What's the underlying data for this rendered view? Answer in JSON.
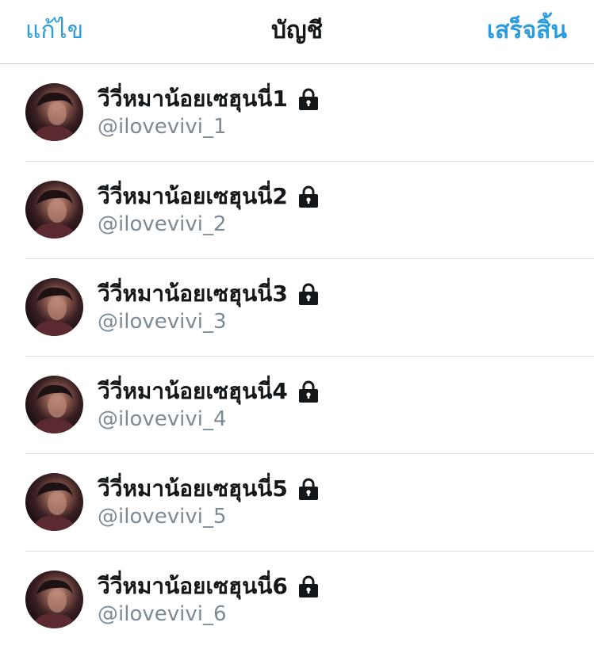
{
  "header": {
    "left_label": "แก้ไข",
    "title": "บัญชี",
    "right_label": "เสร็จสิ้น"
  },
  "accounts": [
    {
      "name": "วีวี่หมาน้อยเซฮุนนี่1",
      "handle": "@ilovevivi_1",
      "icon": "lock-icon"
    },
    {
      "name": "วีวี่หมาน้อยเซฮุนนี่2",
      "handle": "@ilovevivi_2",
      "icon": "lock-icon"
    },
    {
      "name": "วีวี่หมาน้อยเซฮุนนี่3",
      "handle": "@ilovevivi_3",
      "icon": "lock-icon"
    },
    {
      "name": "วีวี่หมาน้อยเซฮุนนี่4",
      "handle": "@ilovevivi_4",
      "icon": "lock-icon"
    },
    {
      "name": "วีวี่หมาน้อยเซฮุนนี่5",
      "handle": "@ilovevivi_5",
      "icon": "lock-icon"
    },
    {
      "name": "วีวี่หมาน้อยเซฮุนนี่6",
      "handle": "@ilovevivi_6",
      "icon": "lock-icon"
    }
  ],
  "colors": {
    "accent": "#2b9cdc",
    "text_primary": "#14171a",
    "text_secondary": "#7c8a96",
    "divider": "#dcdde0"
  }
}
